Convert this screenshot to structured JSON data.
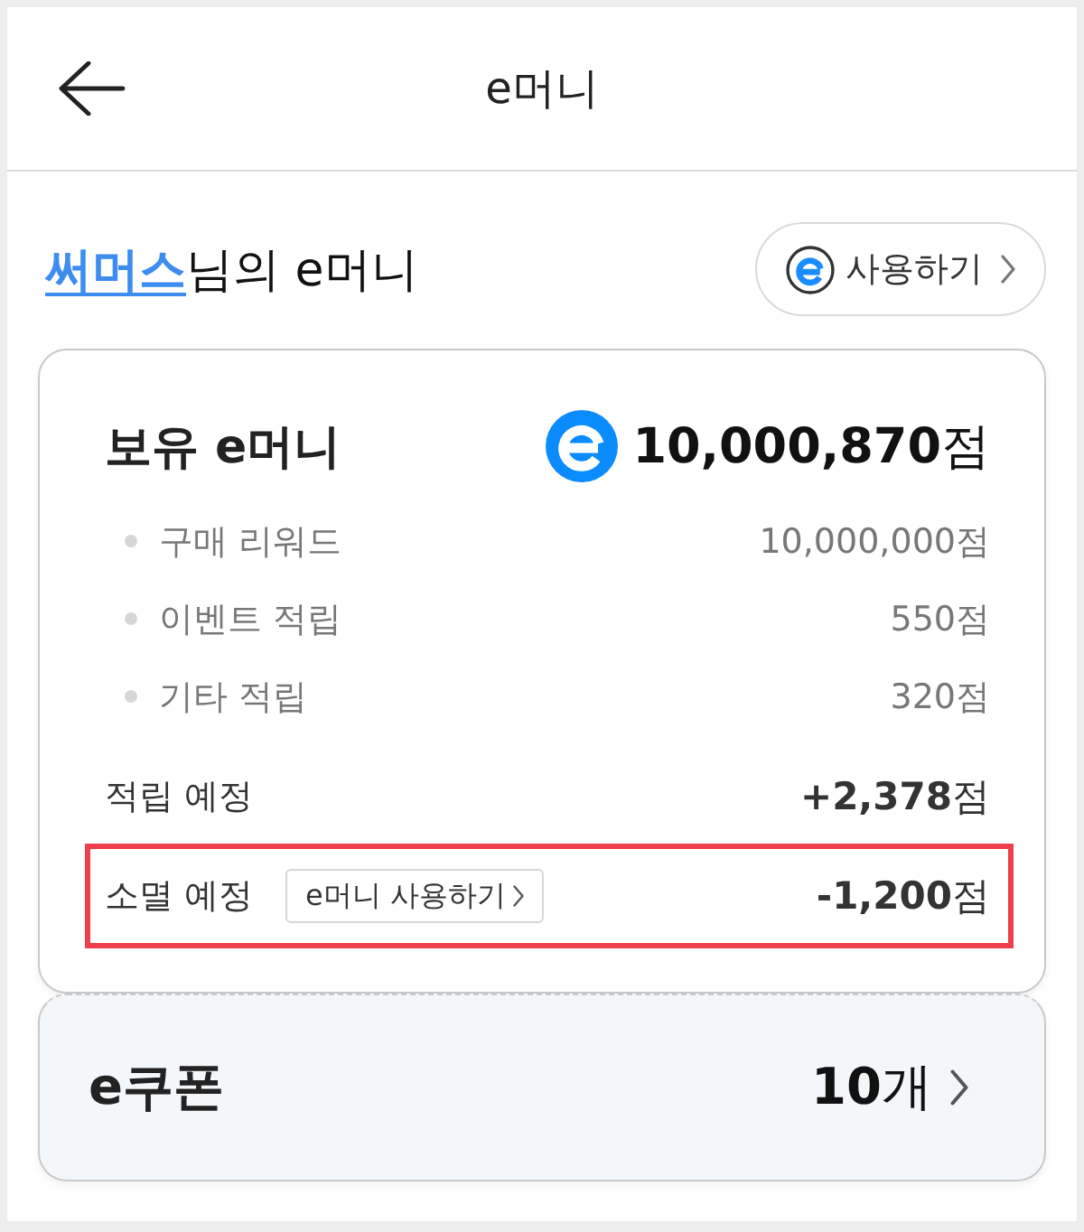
{
  "header": {
    "title": "e머니"
  },
  "greeting": {
    "name": "써머스",
    "suffix": "님의 e머니",
    "use_button": {
      "label": "사용하기"
    }
  },
  "balance_card": {
    "title": "보유 e머니",
    "total": "**10,000,870**점",
    "breakdown": [
      {
        "label": "구매 리워드",
        "value": "10,000,000점"
      },
      {
        "label": "이벤트 적립",
        "value": "550점"
      },
      {
        "label": "기타 적립",
        "value": "320점"
      }
    ],
    "pending": {
      "label": "적립 예정",
      "value": "**+2,378**점"
    },
    "expiring": {
      "label": "소멸 예정",
      "button": "e머니 사용하기",
      "value": "**-1,200**점",
      "highlighted": true
    }
  },
  "coupon_card": {
    "title": "e쿠폰",
    "count": "**10**개"
  }
}
